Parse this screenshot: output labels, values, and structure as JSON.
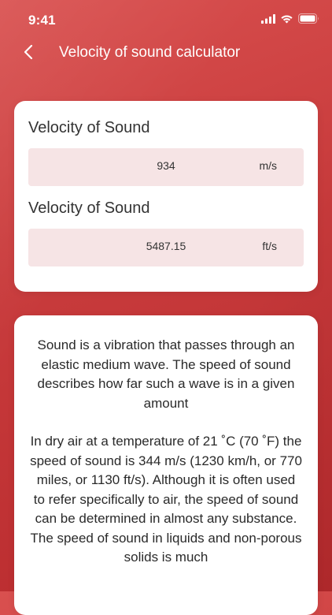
{
  "status_bar": {
    "time": "9:41"
  },
  "header": {
    "title": "Velocity of sound calculator",
    "back_icon": "chevron-left-icon"
  },
  "results": [
    {
      "label": "Velocity of Sound",
      "value": "934",
      "unit": "m/s"
    },
    {
      "label": "Velocity of Sound",
      "value": "5487.15",
      "unit": "ft/s"
    }
  ],
  "description": {
    "paragraph_1": "Sound is a vibration that passes through an elastic medium wave. The speed of sound describes how far such a wave is in a given amount",
    "paragraph_2": "In dry air at a temperature of 21 ˚C (70 ˚F) the speed of sound is 344 m/s (1230 km/h, or 770 miles, or 1130 ft/s). Although it is often used to refer specifically to air, the speed of sound can be determined in almost any substance. The speed of sound in liquids and non-porous solids is much"
  },
  "colors": {
    "background": "#c73a3b",
    "field_background": "#f6e4e5",
    "card": "#ffffff"
  }
}
